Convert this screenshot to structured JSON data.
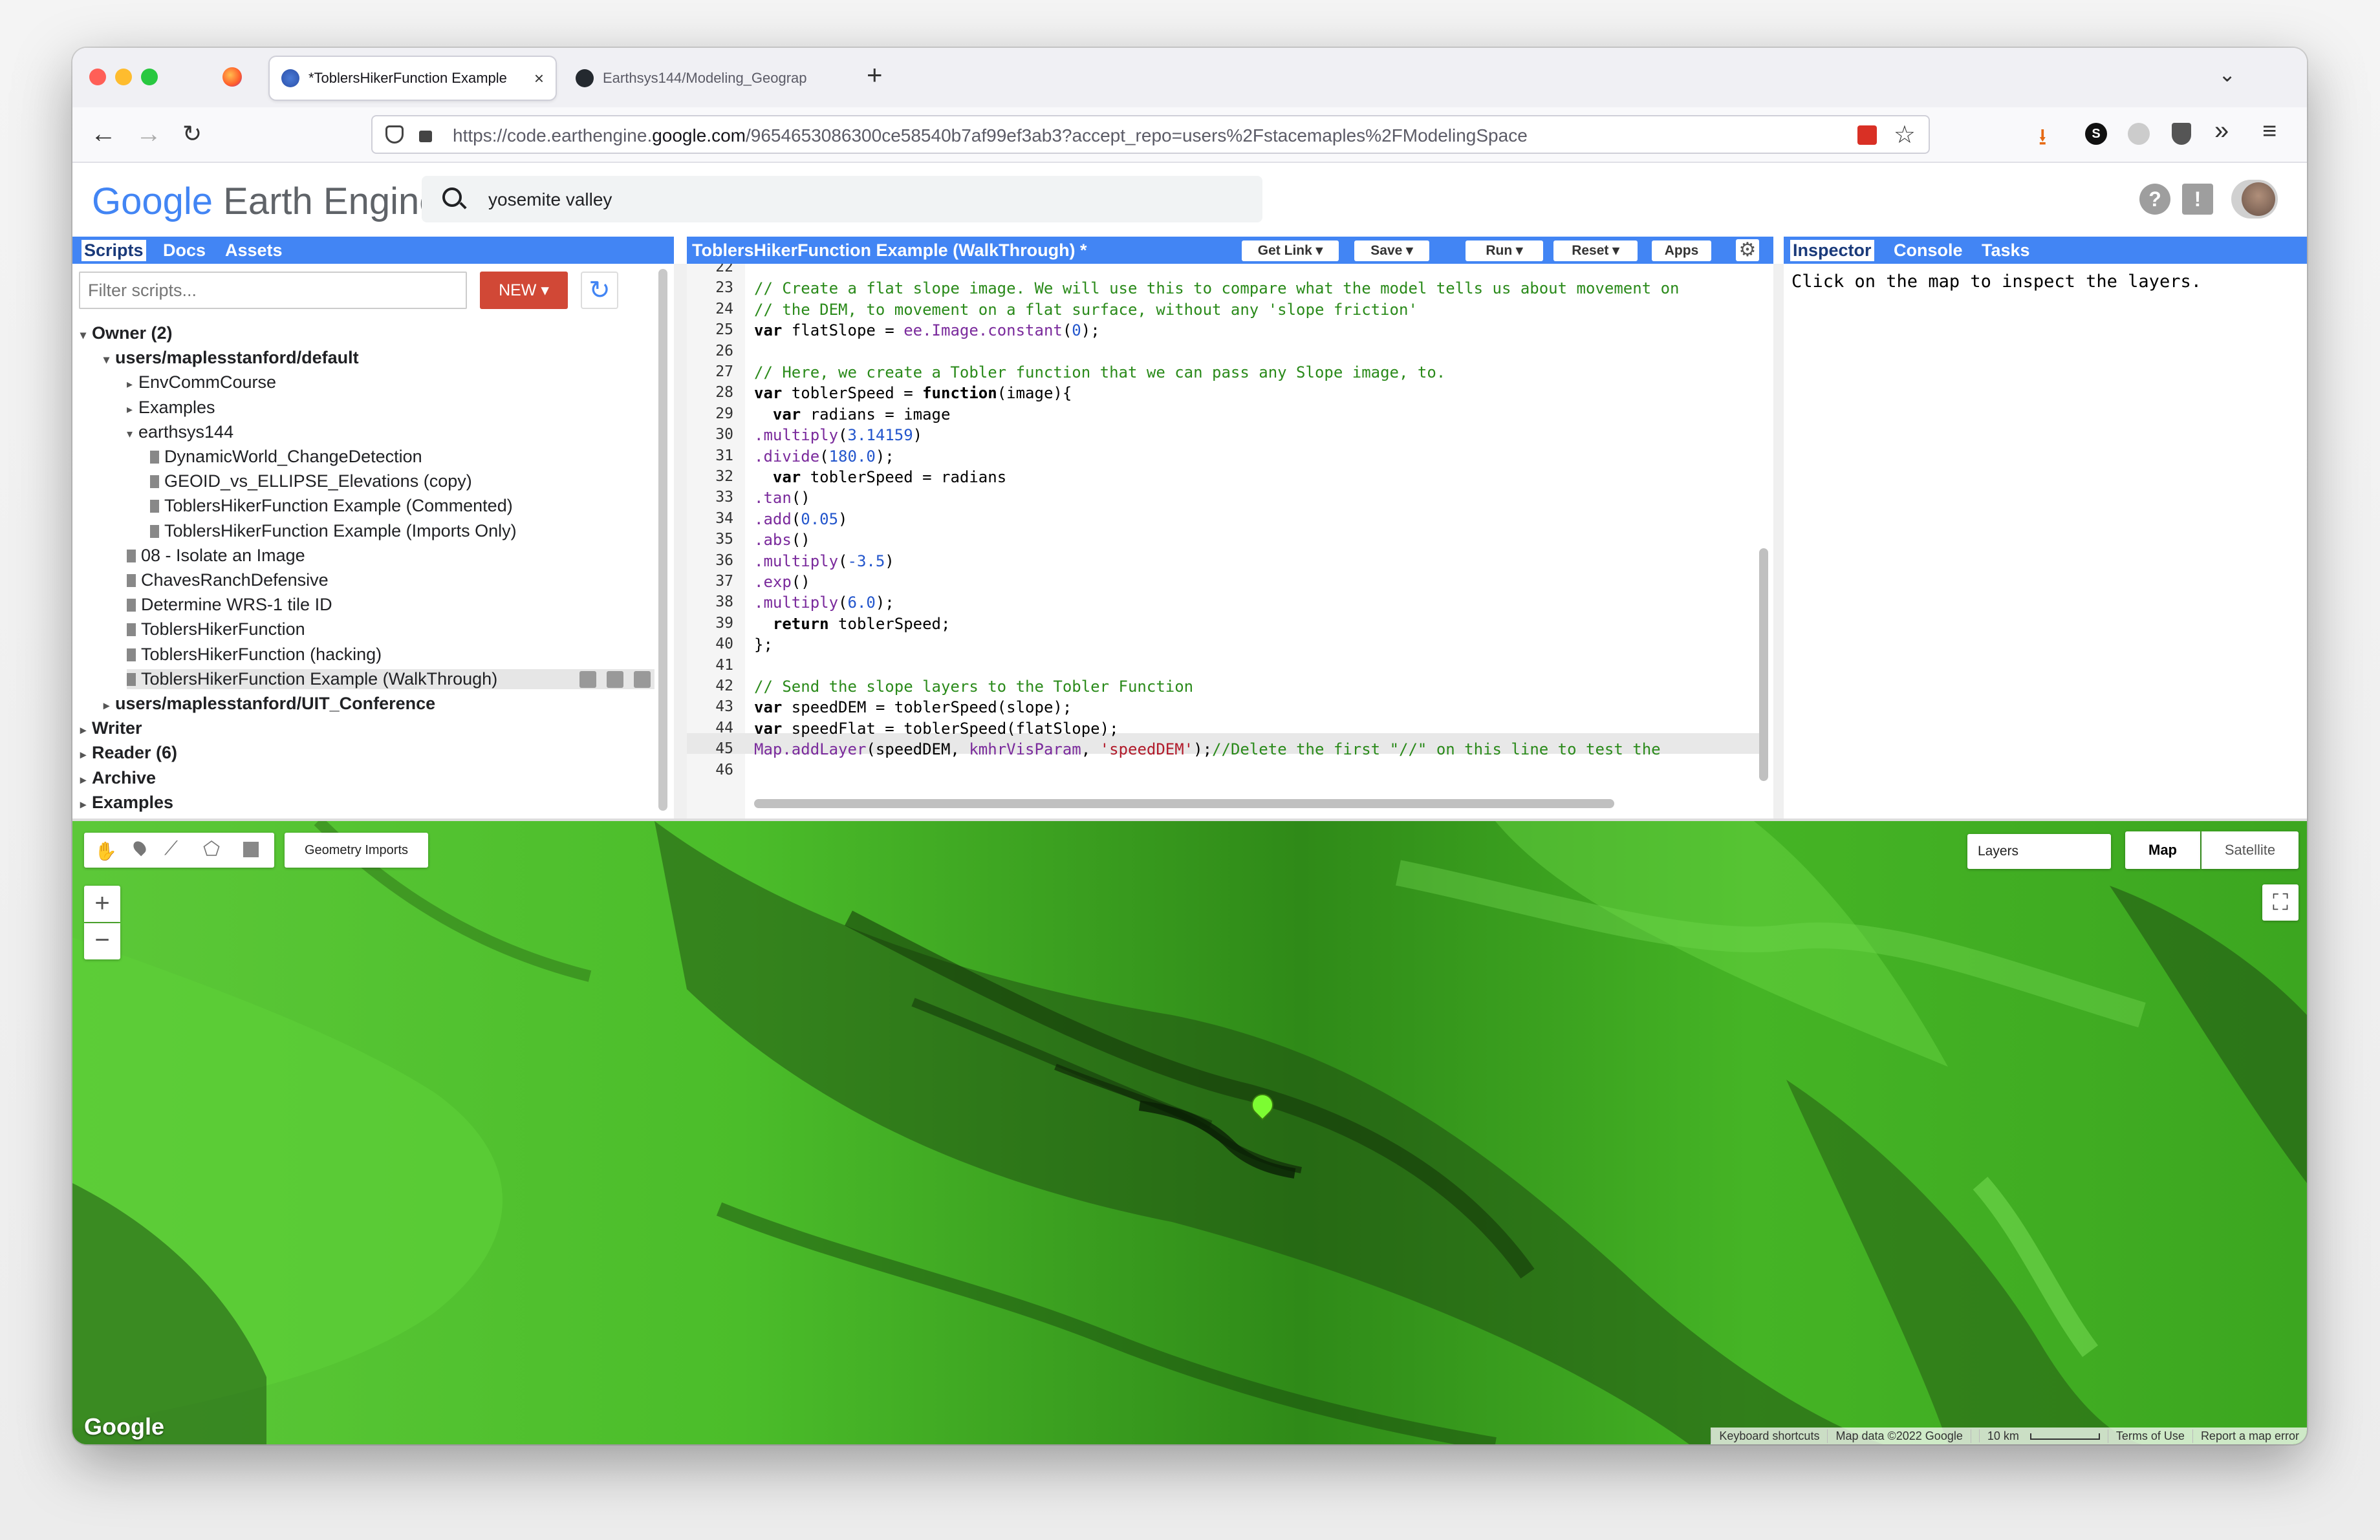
{
  "browser": {
    "tabs": [
      {
        "title": "*ToblersHikerFunction Example",
        "active": true
      },
      {
        "title": "Earthsys144/Modeling_Geograp",
        "active": false
      }
    ],
    "new_tab": "+",
    "url_prefix": "https://code.earthengine.",
    "url_domain": "google.com",
    "url_path": "/9654653086300ce58540b7af99ef3ab3?accept_repo=users%2Fstacemaples%2FModelingSpace"
  },
  "gee": {
    "logo_google": "Google",
    "logo_product": "Earth Engine",
    "search_value": "yosemite valley",
    "help_icon": "?",
    "feedback_icon": "!"
  },
  "left_panel": {
    "tabs": [
      "Scripts",
      "Docs",
      "Assets"
    ],
    "filter_placeholder": "Filter scripts...",
    "new_label": "NEW",
    "tree": [
      {
        "label": "Owner (2)",
        "bold": true,
        "depth": 0,
        "kind": "folder-open"
      },
      {
        "label": "users/maplesstanford/default",
        "bold": true,
        "depth": 1,
        "kind": "folder-open"
      },
      {
        "label": "EnvCommCourse",
        "bold": false,
        "depth": 2,
        "kind": "folder"
      },
      {
        "label": "Examples",
        "bold": false,
        "depth": 2,
        "kind": "folder"
      },
      {
        "label": "earthsys144",
        "bold": false,
        "depth": 2,
        "kind": "folder-open"
      },
      {
        "label": "DynamicWorld_ChangeDetection",
        "bold": false,
        "depth": 3,
        "kind": "file"
      },
      {
        "label": "GEOID_vs_ELLIPSE_Elevations (copy)",
        "bold": false,
        "depth": 3,
        "kind": "file"
      },
      {
        "label": "ToblersHikerFunction Example (Commented)",
        "bold": false,
        "depth": 3,
        "kind": "file"
      },
      {
        "label": "ToblersHikerFunction Example (Imports Only)",
        "bold": false,
        "depth": 3,
        "kind": "file"
      },
      {
        "label": "08 - Isolate an Image",
        "bold": false,
        "depth": 2,
        "kind": "file"
      },
      {
        "label": "ChavesRanchDefensive",
        "bold": false,
        "depth": 2,
        "kind": "file"
      },
      {
        "label": "Determine WRS-1 tile ID",
        "bold": false,
        "depth": 2,
        "kind": "file"
      },
      {
        "label": "ToblersHikerFunction",
        "bold": false,
        "depth": 2,
        "kind": "file"
      },
      {
        "label": "ToblersHikerFunction (hacking)",
        "bold": false,
        "depth": 2,
        "kind": "file"
      },
      {
        "label": "ToblersHikerFunction Example (WalkThrough)",
        "bold": false,
        "depth": 2,
        "kind": "file",
        "selected": true
      },
      {
        "label": "users/maplesstanford/UIT_Conference",
        "bold": true,
        "depth": 1,
        "kind": "folder"
      },
      {
        "label": "Writer",
        "bold": true,
        "depth": 0,
        "kind": "folder"
      },
      {
        "label": "Reader (6)",
        "bold": true,
        "depth": 0,
        "kind": "folder"
      },
      {
        "label": "Archive",
        "bold": true,
        "depth": 0,
        "kind": "folder"
      },
      {
        "label": "Examples",
        "bold": true,
        "depth": 0,
        "kind": "folder"
      }
    ]
  },
  "editor": {
    "title": "ToblersHikerFunction Example (WalkThrough) *",
    "buttons": [
      "Get Link",
      "Save",
      "Run",
      "Reset",
      "Apps"
    ],
    "lines": [
      {
        "n": "22",
        "html": ""
      },
      {
        "n": "23",
        "html": "<span class='cm'>// Create a flat slope image. We will use this to compare what the model tells us about movement on</span>"
      },
      {
        "n": "24",
        "html": "<span class='cm'>// the DEM, to movement on a flat surface, without any 'slope friction'</span>"
      },
      {
        "n": "25",
        "html": "<span class='kw'>var</span> flatSlope = <span class='fn'>ee.Image.constant</span>(<span class='num'>0</span>);"
      },
      {
        "n": "26",
        "html": ""
      },
      {
        "n": "27",
        "html": "<span class='cm'>// Here, we create a Tobler function that we can pass any Slope image, to.</span>"
      },
      {
        "n": "28",
        "html": "<span class='kw'>var</span> toblerSpeed = <span class='kw'>function</span>(image){"
      },
      {
        "n": "29",
        "html": "  <span class='kw'>var</span> radians = image"
      },
      {
        "n": "30",
        "html": "<span class='fn'>.multiply</span>(<span class='num'>3.14159</span>)"
      },
      {
        "n": "31",
        "html": "<span class='fn'>.divide</span>(<span class='num'>180.0</span>);"
      },
      {
        "n": "32",
        "html": "  <span class='kw'>var</span> toblerSpeed = radians"
      },
      {
        "n": "33",
        "html": "<span class='fn'>.tan</span>()"
      },
      {
        "n": "34",
        "html": "<span class='fn'>.add</span>(<span class='num'>0.05</span>)"
      },
      {
        "n": "35",
        "html": "<span class='fn'>.abs</span>()"
      },
      {
        "n": "36",
        "html": "<span class='fn'>.multiply</span>(<span class='num'>-3.5</span>)"
      },
      {
        "n": "37",
        "html": "<span class='fn'>.exp</span>()"
      },
      {
        "n": "38",
        "html": "<span class='fn'>.multiply</span>(<span class='num'>6.0</span>);"
      },
      {
        "n": "39",
        "html": "  <span class='kw'>return</span> toblerSpeed;"
      },
      {
        "n": "40",
        "html": "};"
      },
      {
        "n": "41",
        "html": ""
      },
      {
        "n": "42",
        "html": "<span class='cm'>// Send the slope layers to the Tobler Function</span>"
      },
      {
        "n": "43",
        "html": "<span class='kw'>var</span> speedDEM = toblerSpeed(slope);"
      },
      {
        "n": "44",
        "html": "<span class='kw'>var</span> speedFlat = toblerSpeed(flatSlope);"
      },
      {
        "n": "45",
        "html": "<span class='fn'>Map.addLayer</span>(speedDEM, <span class='fn'>kmhrVisParam</span>, <span class='str'>'speedDEM'</span>);<span class='cm'>//Delete the first \"//\" on this line to test the</span>"
      },
      {
        "n": "46",
        "html": ""
      }
    ]
  },
  "right_panel": {
    "tabs": [
      "Inspector",
      "Console",
      "Tasks"
    ],
    "message": "Click on the map to inspect the layers."
  },
  "map": {
    "geometry_imports": "Geometry Imports",
    "zoom_in": "+",
    "zoom_out": "−",
    "layers_label": "Layers",
    "map_type_map": "Map",
    "map_type_satellite": "Satellite",
    "google_logo": "Google",
    "footer": [
      "Keyboard shortcuts",
      "Map data ©2022 Google",
      "10 km",
      "Terms of Use",
      "Report a map error"
    ],
    "colors": {
      "base_green": "#3fa820",
      "light_green": "#58c832",
      "dark_green": "#1f4a10"
    }
  },
  "colors": {
    "panel_blue": "#4285f4",
    "new_button_red": "#d14836"
  }
}
